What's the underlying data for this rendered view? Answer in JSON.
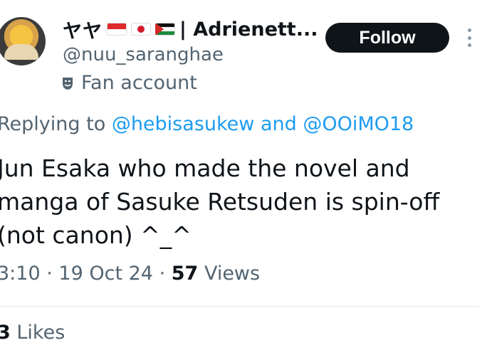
{
  "header": {
    "kana_name": "ヤヤ",
    "display_name": "| Adrienett...",
    "handle": "@nuu_saranghae",
    "badge_label": "Fan account",
    "follow_label": "Follow",
    "flags": [
      "indonesia-flag-icon",
      "japan-flag-icon",
      "palestine-flag-icon"
    ]
  },
  "reply": {
    "prefix": "Replying to",
    "mention_1": "@hebisasukew",
    "joiner": "and",
    "mention_2": "@OOiMO18"
  },
  "tweet": {
    "lines": [
      "Jun Esaka who made the novel and",
      "manga of Sasuke Retsuden is spin-off",
      "(not canon) ^_^"
    ]
  },
  "meta": {
    "time": "3:10",
    "separator": "·",
    "date": "19 Oct 24",
    "views_count": "57",
    "views_label": "Views"
  },
  "engagement": {
    "likes_count": "3",
    "likes_label": "Likes"
  },
  "colors": {
    "text": "#0f1419",
    "secondary": "#536471",
    "link": "#1d9bf0",
    "button_bg": "#0f1419"
  }
}
